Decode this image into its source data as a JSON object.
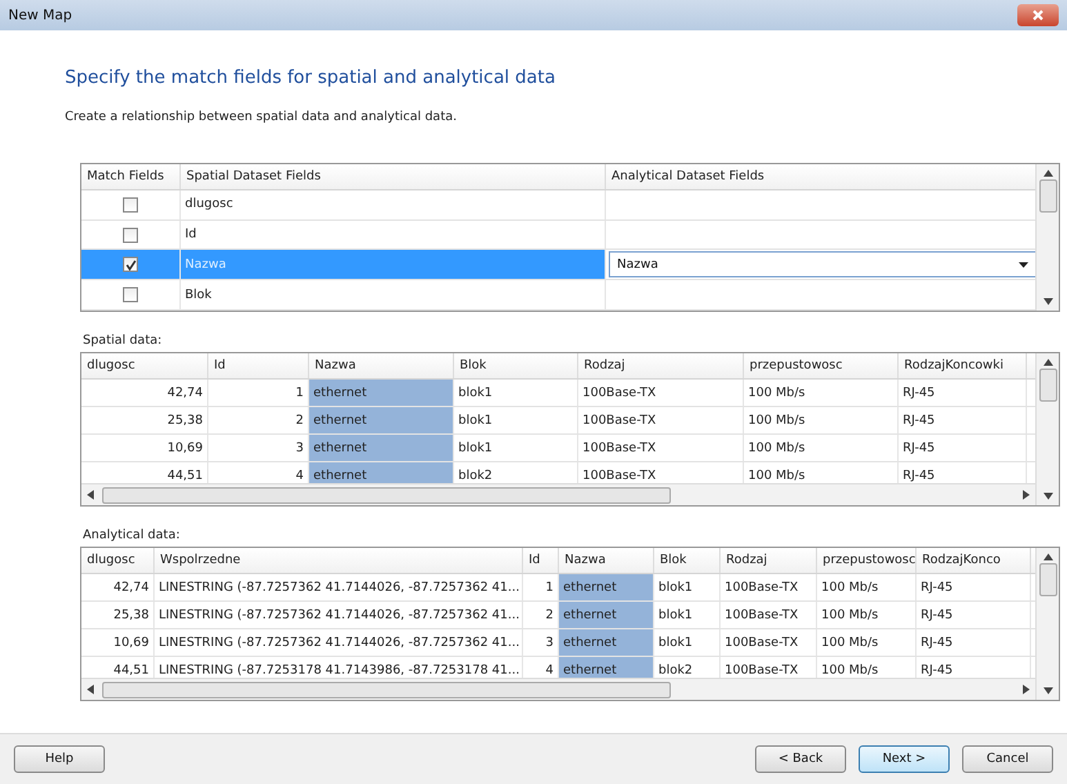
{
  "window": {
    "title": "New Map"
  },
  "heading": "Specify the match fields for spatial and analytical data",
  "description": "Create a relationship between spatial data and analytical data.",
  "match_table": {
    "columns": [
      "Match Fields",
      "Spatial Dataset Fields",
      "Analytical Dataset Fields"
    ],
    "rows": [
      {
        "checked": false,
        "selected": false,
        "spatial_field": "dlugosc"
      },
      {
        "checked": false,
        "selected": false,
        "spatial_field": "Id"
      },
      {
        "checked": true,
        "selected": true,
        "spatial_field": "Nazwa",
        "analytical_field": "Nazwa"
      },
      {
        "checked": false,
        "selected": false,
        "spatial_field": "Blok"
      }
    ]
  },
  "spatial_data": {
    "label": "Spatial data:",
    "columns": [
      {
        "name": "dlugosc",
        "kind": "number",
        "selected": false
      },
      {
        "name": "Id",
        "kind": "number",
        "selected": false
      },
      {
        "name": "Nazwa",
        "kind": "text",
        "selected": true
      },
      {
        "name": "Blok",
        "kind": "text",
        "selected": false
      },
      {
        "name": "Rodzaj",
        "kind": "text",
        "selected": false
      },
      {
        "name": "przepustowosc",
        "kind": "text",
        "selected": false
      },
      {
        "name": "RodzajKoncowki",
        "kind": "text",
        "selected": false
      }
    ],
    "rows": [
      [
        "42,74",
        "1",
        "ethernet",
        "blok1",
        "100Base-TX",
        "100 Mb/s",
        "RJ-45"
      ],
      [
        "25,38",
        "2",
        "ethernet",
        "blok1",
        "100Base-TX",
        "100 Mb/s",
        "RJ-45"
      ],
      [
        "10,69",
        "3",
        "ethernet",
        "blok1",
        "100Base-TX",
        "100 Mb/s",
        "RJ-45"
      ],
      [
        "44,51",
        "4",
        "ethernet",
        "blok2",
        "100Base-TX",
        "100 Mb/s",
        "RJ-45"
      ]
    ]
  },
  "analytical_data": {
    "label": "Analytical data:",
    "columns": [
      {
        "name": "dlugosc",
        "kind": "number",
        "selected": false
      },
      {
        "name": "Wspolrzedne",
        "kind": "text",
        "selected": false
      },
      {
        "name": "Id",
        "kind": "number",
        "selected": false
      },
      {
        "name": "Nazwa",
        "kind": "text",
        "selected": true
      },
      {
        "name": "Blok",
        "kind": "text",
        "selected": false
      },
      {
        "name": "Rodzaj",
        "kind": "text",
        "selected": false
      },
      {
        "name": "przepustowosc",
        "kind": "text",
        "selected": false
      },
      {
        "name": "RodzajKonco",
        "kind": "text",
        "selected": false
      }
    ],
    "rows": [
      [
        "42,74",
        "LINESTRING (-87.7257362 41.7144026, -87.7257362 41...",
        "1",
        "ethernet",
        "blok1",
        "100Base-TX",
        "100 Mb/s",
        "RJ-45"
      ],
      [
        "25,38",
        "LINESTRING (-87.7257362 41.7144026, -87.7257362 41...",
        "2",
        "ethernet",
        "blok1",
        "100Base-TX",
        "100 Mb/s",
        "RJ-45"
      ],
      [
        "10,69",
        "LINESTRING (-87.7257362 41.7144026, -87.7257362 41...",
        "3",
        "ethernet",
        "blok1",
        "100Base-TX",
        "100 Mb/s",
        "RJ-45"
      ],
      [
        "44,51",
        "LINESTRING (-87.7253178 41.7143986, -87.7253178 41...",
        "4",
        "ethernet",
        "blok2",
        "100Base-TX",
        "100 Mb/s",
        "RJ-45"
      ]
    ]
  },
  "buttons": [
    {
      "label": "Help",
      "kind": "help",
      "default": false
    },
    {
      "label": "< Back",
      "kind": "nav",
      "default": false
    },
    {
      "label": "Next >",
      "kind": "nav",
      "default": true
    },
    {
      "label": "Cancel",
      "kind": "nav",
      "default": false
    }
  ]
}
